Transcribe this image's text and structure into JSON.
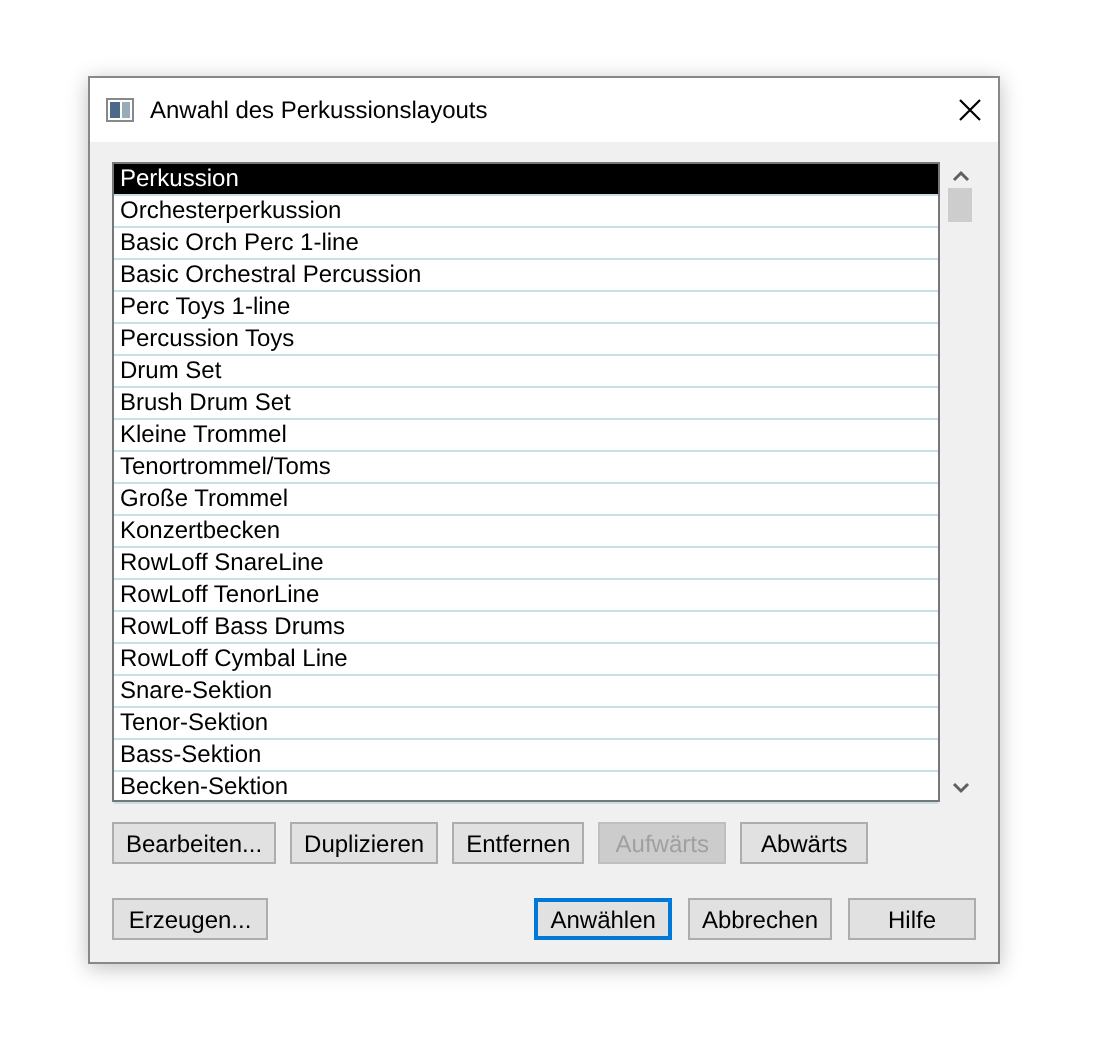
{
  "window": {
    "title": "Anwahl des Perkussionslayouts"
  },
  "list": {
    "items": [
      {
        "label": "Perkussion",
        "selected": true
      },
      {
        "label": "Orchesterperkussion",
        "selected": false
      },
      {
        "label": "Basic Orch Perc 1-line",
        "selected": false
      },
      {
        "label": "Basic Orchestral Percussion",
        "selected": false
      },
      {
        "label": "Perc Toys 1-line",
        "selected": false
      },
      {
        "label": "Percussion Toys",
        "selected": false
      },
      {
        "label": "Drum Set",
        "selected": false
      },
      {
        "label": "Brush Drum Set",
        "selected": false
      },
      {
        "label": "Kleine Trommel",
        "selected": false
      },
      {
        "label": "Tenortrommel/Toms",
        "selected": false
      },
      {
        "label": "Große Trommel",
        "selected": false
      },
      {
        "label": "Konzertbecken",
        "selected": false
      },
      {
        "label": "RowLoff SnareLine",
        "selected": false
      },
      {
        "label": "RowLoff TenorLine",
        "selected": false
      },
      {
        "label": "RowLoff Bass Drums",
        "selected": false
      },
      {
        "label": "RowLoff Cymbal Line",
        "selected": false
      },
      {
        "label": "Snare-Sektion",
        "selected": false
      },
      {
        "label": "Tenor-Sektion",
        "selected": false
      },
      {
        "label": "Bass-Sektion",
        "selected": false
      },
      {
        "label": "Becken-Sektion",
        "selected": false
      }
    ]
  },
  "edit_buttons": [
    {
      "label": "Bearbeiten...",
      "disabled": false
    },
    {
      "label": "Duplizieren",
      "disabled": false
    },
    {
      "label": "Entfernen",
      "disabled": false
    },
    {
      "label": "Aufwärts",
      "disabled": true
    },
    {
      "label": "Abwärts",
      "disabled": false
    }
  ],
  "create_button": {
    "label": "Erzeugen...",
    "default": false
  },
  "dialog_buttons": [
    {
      "label": "Anwählen",
      "default": true
    },
    {
      "label": "Abbrechen",
      "default": false
    },
    {
      "label": "Hilfe",
      "default": false
    }
  ]
}
